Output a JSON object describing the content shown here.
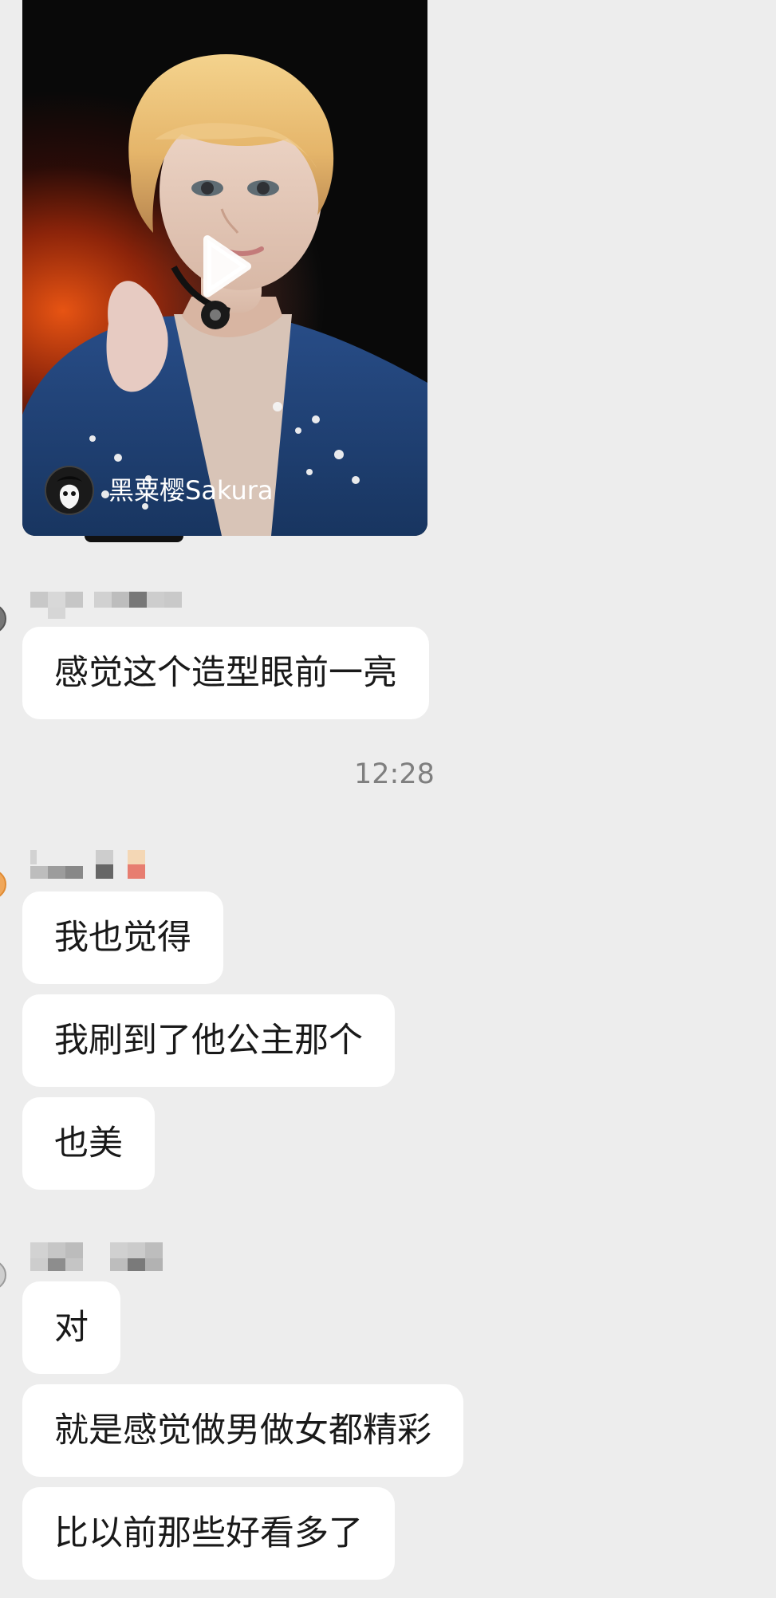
{
  "shared_video": {
    "author_name": "黑粟樱Sakura",
    "play_icon": "play-icon",
    "author_avatar_icon": "author-avatar-icon"
  },
  "messages": {
    "group1": [
      {
        "text": "感觉这个造型眼前一亮"
      }
    ],
    "timestamp": "12:28",
    "group2": [
      {
        "text": "我也觉得"
      },
      {
        "text": "我刷到了他公主那个"
      },
      {
        "text": "也美"
      }
    ],
    "group3": [
      {
        "text": "对"
      },
      {
        "text": "就是感觉做男做女都精彩"
      },
      {
        "text": "比以前那些好看多了"
      }
    ]
  },
  "colors": {
    "background": "#ededed",
    "bubble": "#ffffff",
    "text": "#191919",
    "timestamp": "#7f7f7f"
  }
}
